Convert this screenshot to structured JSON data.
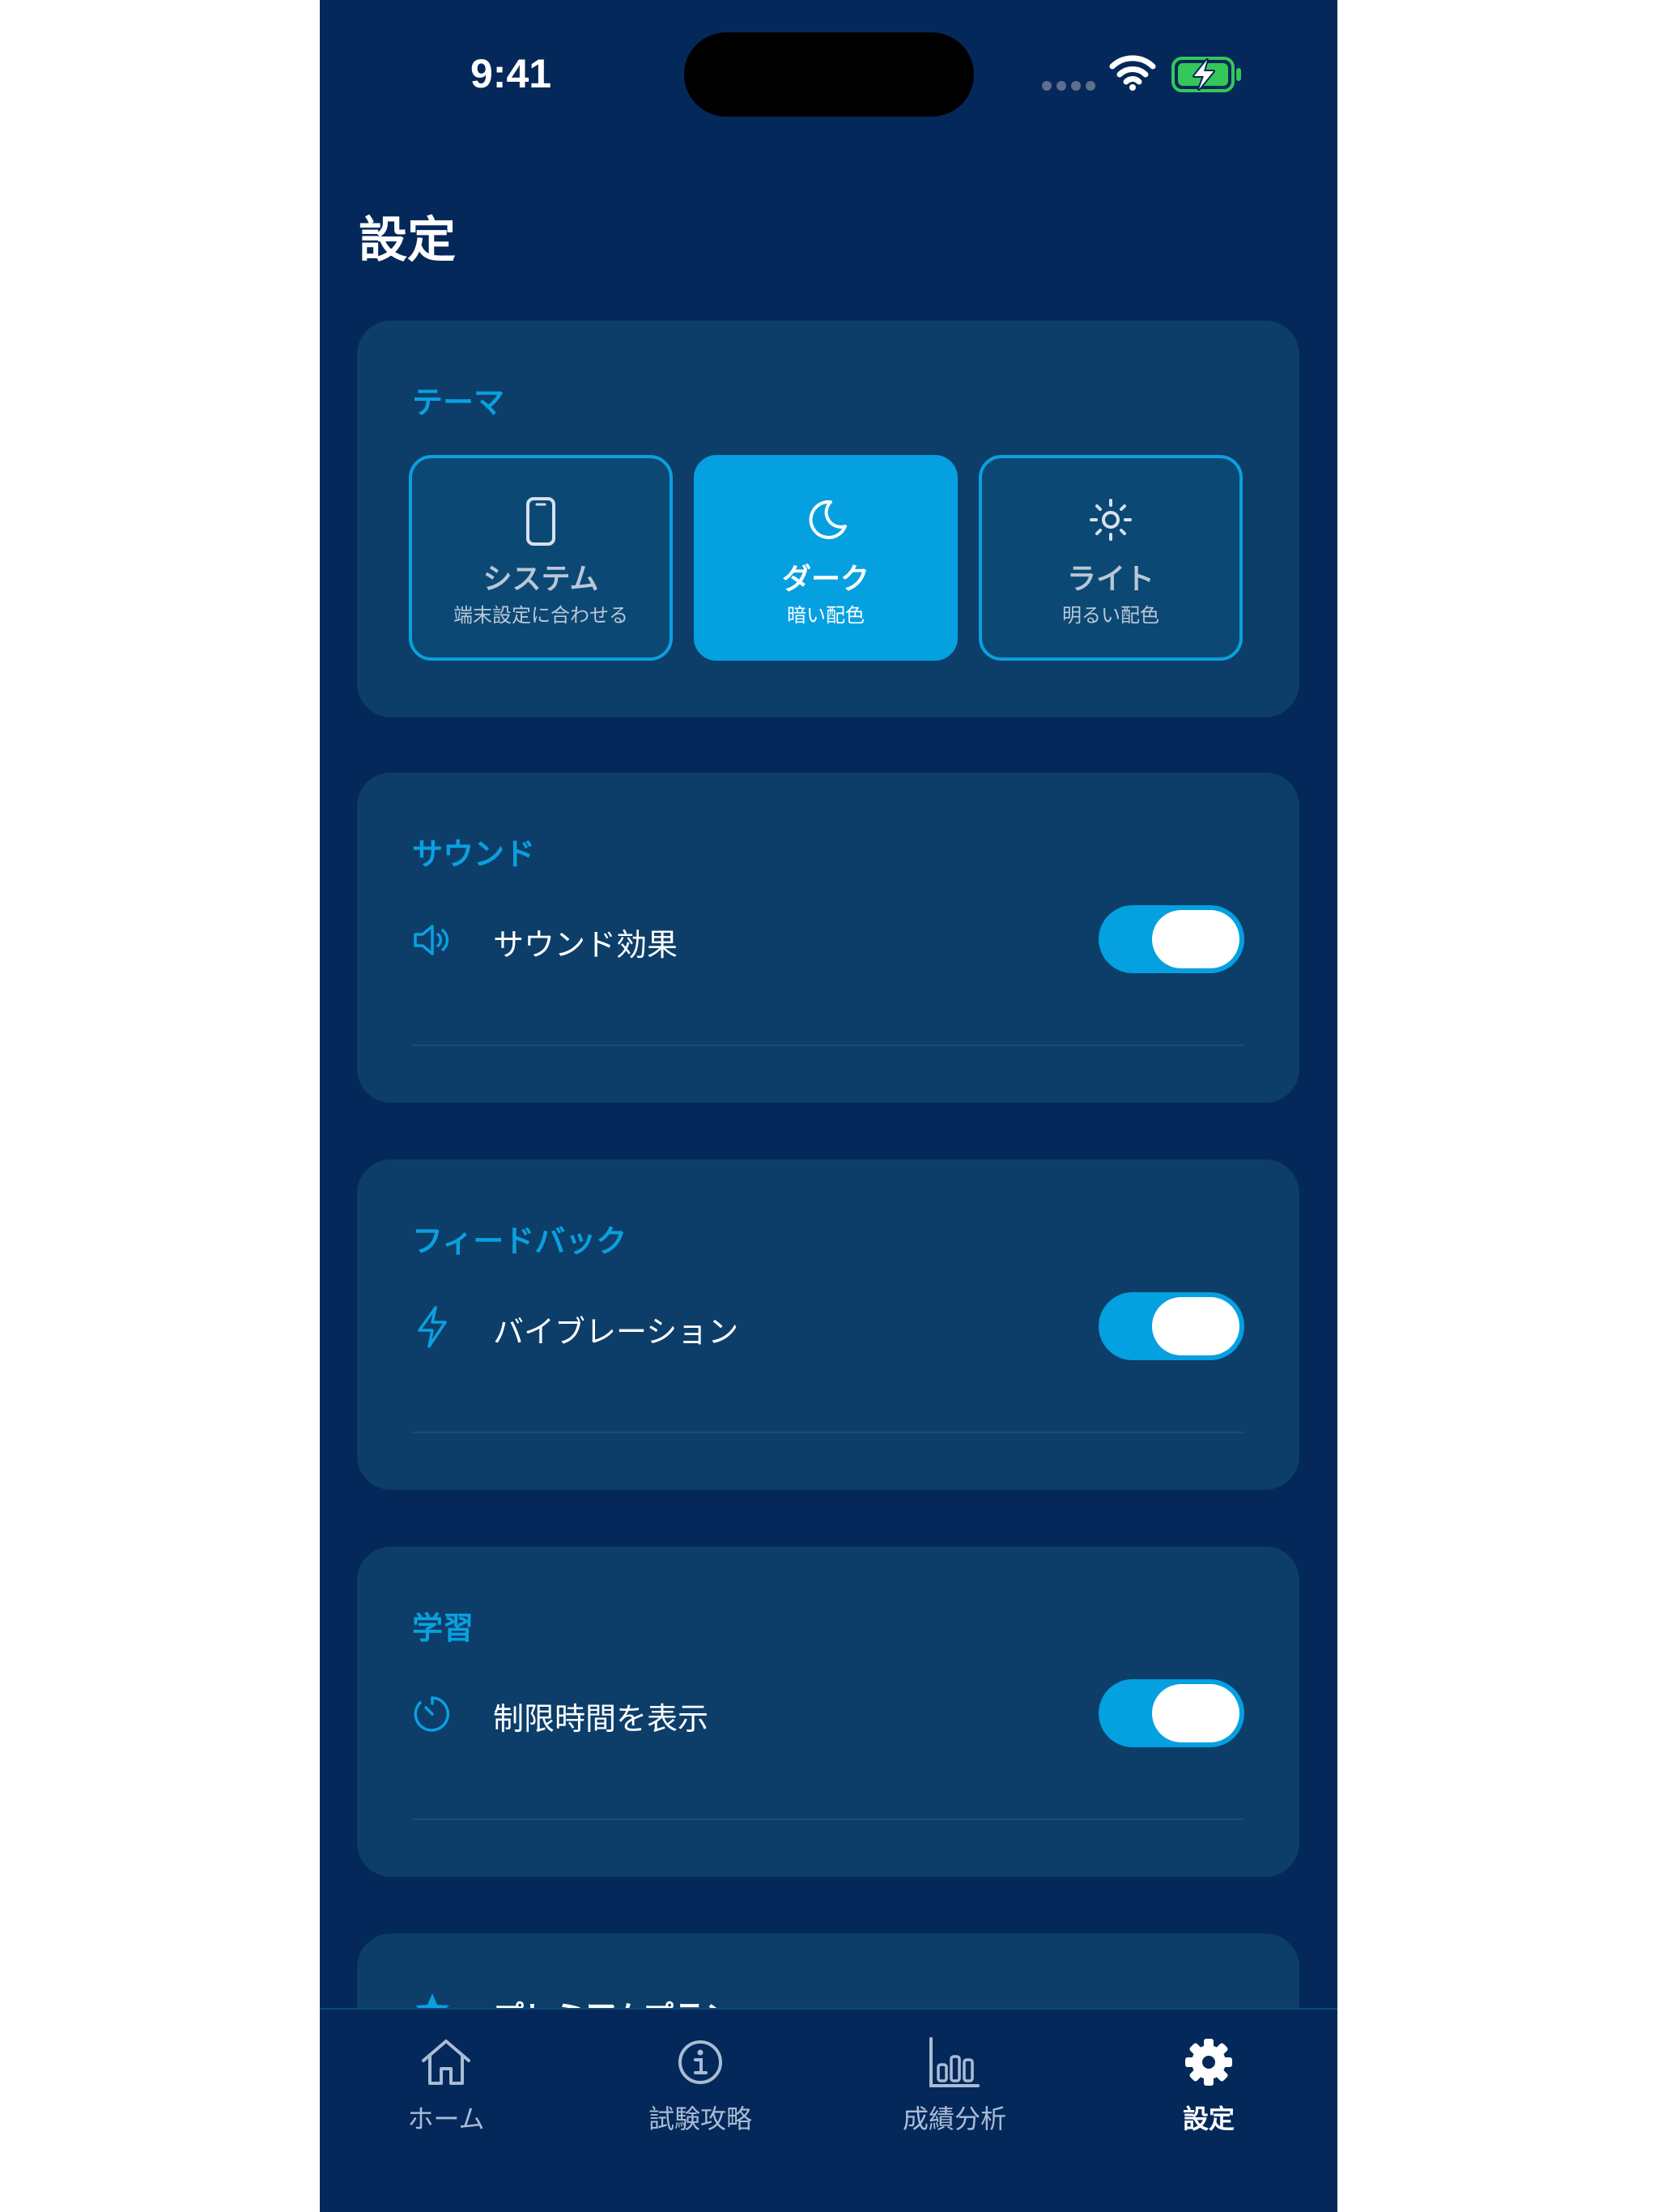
{
  "status_bar": {
    "time": "9:41"
  },
  "page": {
    "title": "設定"
  },
  "theme_section": {
    "title": "テーマ",
    "options": [
      {
        "label": "システム",
        "sub": "端末設定に合わせる",
        "icon": "phone-icon"
      },
      {
        "label": "ダーク",
        "sub": "暗い配色",
        "icon": "moon-icon"
      },
      {
        "label": "ライト",
        "sub": "明るい配色",
        "icon": "sun-icon"
      }
    ],
    "selected": "ダーク"
  },
  "sound_section": {
    "title": "サウンド",
    "items": [
      {
        "label": "サウンド効果",
        "icon": "speaker-icon",
        "enabled": true
      }
    ]
  },
  "feedback_section": {
    "title": "フィードバック",
    "items": [
      {
        "label": "バイブレーション",
        "icon": "bolt-icon",
        "enabled": true
      }
    ]
  },
  "study_section": {
    "title": "学習",
    "items": [
      {
        "label": "制限時間を表示",
        "icon": "timer-icon",
        "enabled": true
      }
    ]
  },
  "premium_section": {
    "title": "プレミアムプラン",
    "icon": "star-icon"
  },
  "tab_bar": {
    "tabs": [
      {
        "label": "ホーム",
        "icon": "home-icon"
      },
      {
        "label": "試験攻略",
        "icon": "info-icon"
      },
      {
        "label": "成績分析",
        "icon": "bar-chart-icon"
      },
      {
        "label": "設定",
        "icon": "gear-icon"
      }
    ],
    "active": "設定"
  },
  "colors": {
    "background": "#04285a",
    "card": "#0c3e69",
    "accent": "#04a0e0",
    "battery": "#34c759"
  }
}
